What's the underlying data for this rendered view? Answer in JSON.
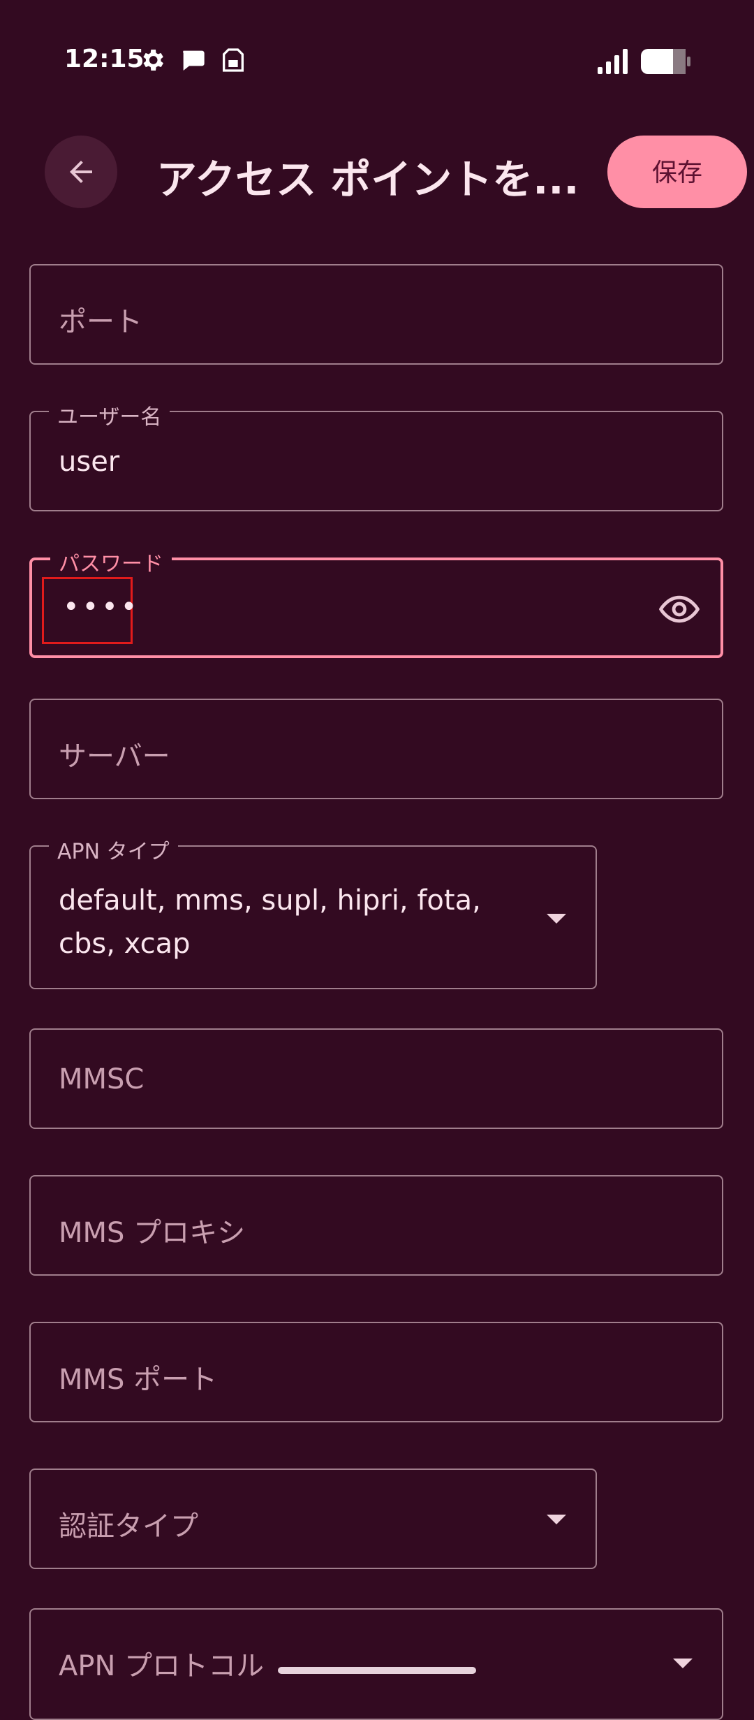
{
  "status": {
    "time": "12:15",
    "icons": [
      "gear-icon",
      "chat-icon",
      "sim-card-icon",
      "signal-icon",
      "battery-icon"
    ]
  },
  "appbar": {
    "title": "アクセス ポイントを...",
    "save_label": "保存"
  },
  "fields": {
    "port": {
      "placeholder": "ポート"
    },
    "username": {
      "label": "ユーザー名",
      "value": "user"
    },
    "password": {
      "label": "パスワード",
      "value": "••••"
    },
    "server": {
      "placeholder": "サーバー"
    },
    "apn_type": {
      "label": "APN タイプ",
      "value_line1": "default, mms, supl, hipri, fota,",
      "value_line2": "cbs, xcap"
    },
    "mmsc": {
      "placeholder": "MMSC"
    },
    "mms_proxy": {
      "placeholder": "MMS プロキシ"
    },
    "mms_port": {
      "placeholder": "MMS ポート"
    },
    "auth_type": {
      "placeholder": "認証タイプ"
    },
    "apn_protocol": {
      "placeholder": "APN プロトコル"
    }
  },
  "colors": {
    "background": "#330a21",
    "accent": "#ff8fa6",
    "outline": "#a07e8c"
  }
}
